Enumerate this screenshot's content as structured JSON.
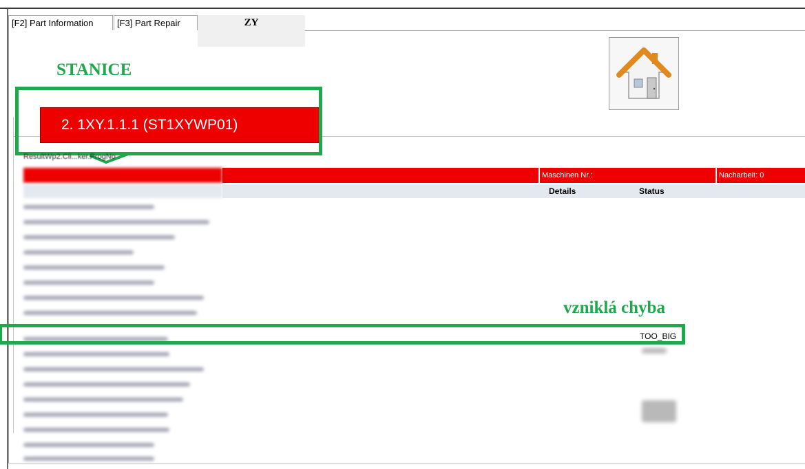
{
  "tabs": [
    {
      "label": "[F2]  Part Information"
    },
    {
      "label": "[F3]  Part Repair"
    },
    {
      "label": "ZY"
    }
  ],
  "annotations": {
    "station_label": "STANICE",
    "error_label": "vzniklá chyba"
  },
  "station": {
    "name": "2. 1XY.1.1.1 (ST1XYWP01)"
  },
  "result_label": "ResultWp2.Cli...ker.ProgNo",
  "info_bar": {
    "machine": "Maschinen Nr.:",
    "rework": "Nacharbeit: 0"
  },
  "table": {
    "headers": {
      "details": "Details",
      "status": "Status"
    },
    "error_row_status": "TOO_BIG"
  },
  "icons": {
    "home": "home-icon"
  },
  "colors": {
    "accent_green": "#1fa84c",
    "alert_red": "#ee0000",
    "header_bg": "#e4e8f0"
  }
}
